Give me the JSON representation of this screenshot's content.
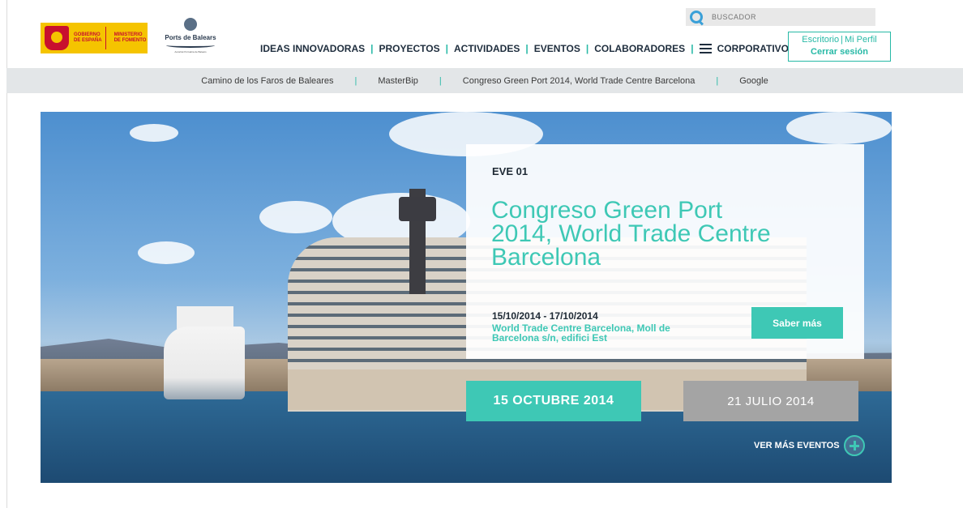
{
  "header": {
    "gov_logo": {
      "line1": "GOBIERNO",
      "line2": "DE ESPAÑA",
      "line3": "MINISTERIO",
      "line4": "DE FOMENTO"
    },
    "ports_logo": {
      "name": "Ports de Balears",
      "subtitle": "Autoritat Portuària de Balears"
    },
    "search": {
      "placeholder": "BUSCADOR",
      "icon": "search-icon"
    },
    "nav": [
      {
        "label": "IDEAS INNOVADORAS"
      },
      {
        "label": "PROYECTOS"
      },
      {
        "label": "ACTIVIDADES"
      },
      {
        "label": "EVENTOS"
      },
      {
        "label": "COLABORADORES"
      },
      {
        "label": "CORPORATIVO",
        "icon": "list-icon"
      }
    ],
    "profile": {
      "escritorio": "Escritorio",
      "separator": "|",
      "mi_perfil": "Mi Perfil",
      "logout": "Cerrar sesión"
    }
  },
  "subnav": {
    "items": [
      {
        "label": "Camino de los Faros de Baleares"
      },
      {
        "label": "MasterBip"
      },
      {
        "label": "Congreso Green Port 2014, World Trade Centre Barcelona"
      },
      {
        "label": "Google"
      }
    ],
    "separator": "|"
  },
  "event": {
    "code": "EVE 01",
    "title": "Congreso Green Port 2014, World Trade Centre Barcelona",
    "dates": "15/10/2014 - 17/10/2014",
    "place": "World Trade Centre Barcelona, Moll de Barcelona s/n, edifici Est",
    "more_button": "Saber más"
  },
  "date_tabs": {
    "active": "15 OCTUBRE 2014",
    "inactive": "21 JULIO 2014"
  },
  "more_events": {
    "label": "VER MÁS EVENTOS",
    "icon": "plus-circle-icon"
  },
  "colors": {
    "accent": "#3ec8b5",
    "nav_text": "#1e2d3d",
    "subnav_bg": "#e3e6e8",
    "inactive_tab": "#a4a4a4"
  }
}
